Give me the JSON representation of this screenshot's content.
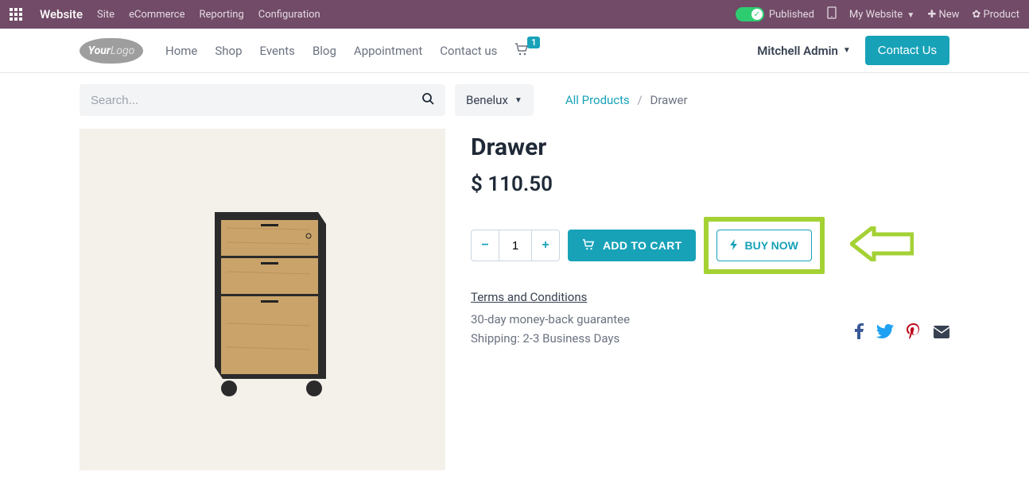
{
  "admin": {
    "app_name": "Website",
    "menus": [
      "Site",
      "eCommerce",
      "Reporting",
      "Configuration"
    ],
    "publish_label": "Published",
    "mobile_label": "",
    "my_website_label": "My Website",
    "new_label": "New",
    "product_label": "Product"
  },
  "nav": {
    "links": [
      "Home",
      "Shop",
      "Events",
      "Blog",
      "Appointment",
      "Contact us"
    ],
    "cart_count": "1",
    "user_name": "Mitchell Admin",
    "contact_btn": "Contact Us"
  },
  "search": {
    "placeholder": "Search...",
    "region": "Benelux"
  },
  "breadcrumb": {
    "root": "All Products",
    "current": "Drawer"
  },
  "product": {
    "title": "Drawer",
    "price": "$ 110.50",
    "qty": "1",
    "add_to_cart": "ADD TO CART",
    "buy_now": "BUY NOW",
    "terms": "Terms and Conditions",
    "guarantee": "30-day money-back guarantee",
    "shipping": "Shipping: 2-3 Business Days"
  },
  "annotation": {
    "highlight_target": "buy-now-button",
    "arrow_color": "#a4d134"
  }
}
